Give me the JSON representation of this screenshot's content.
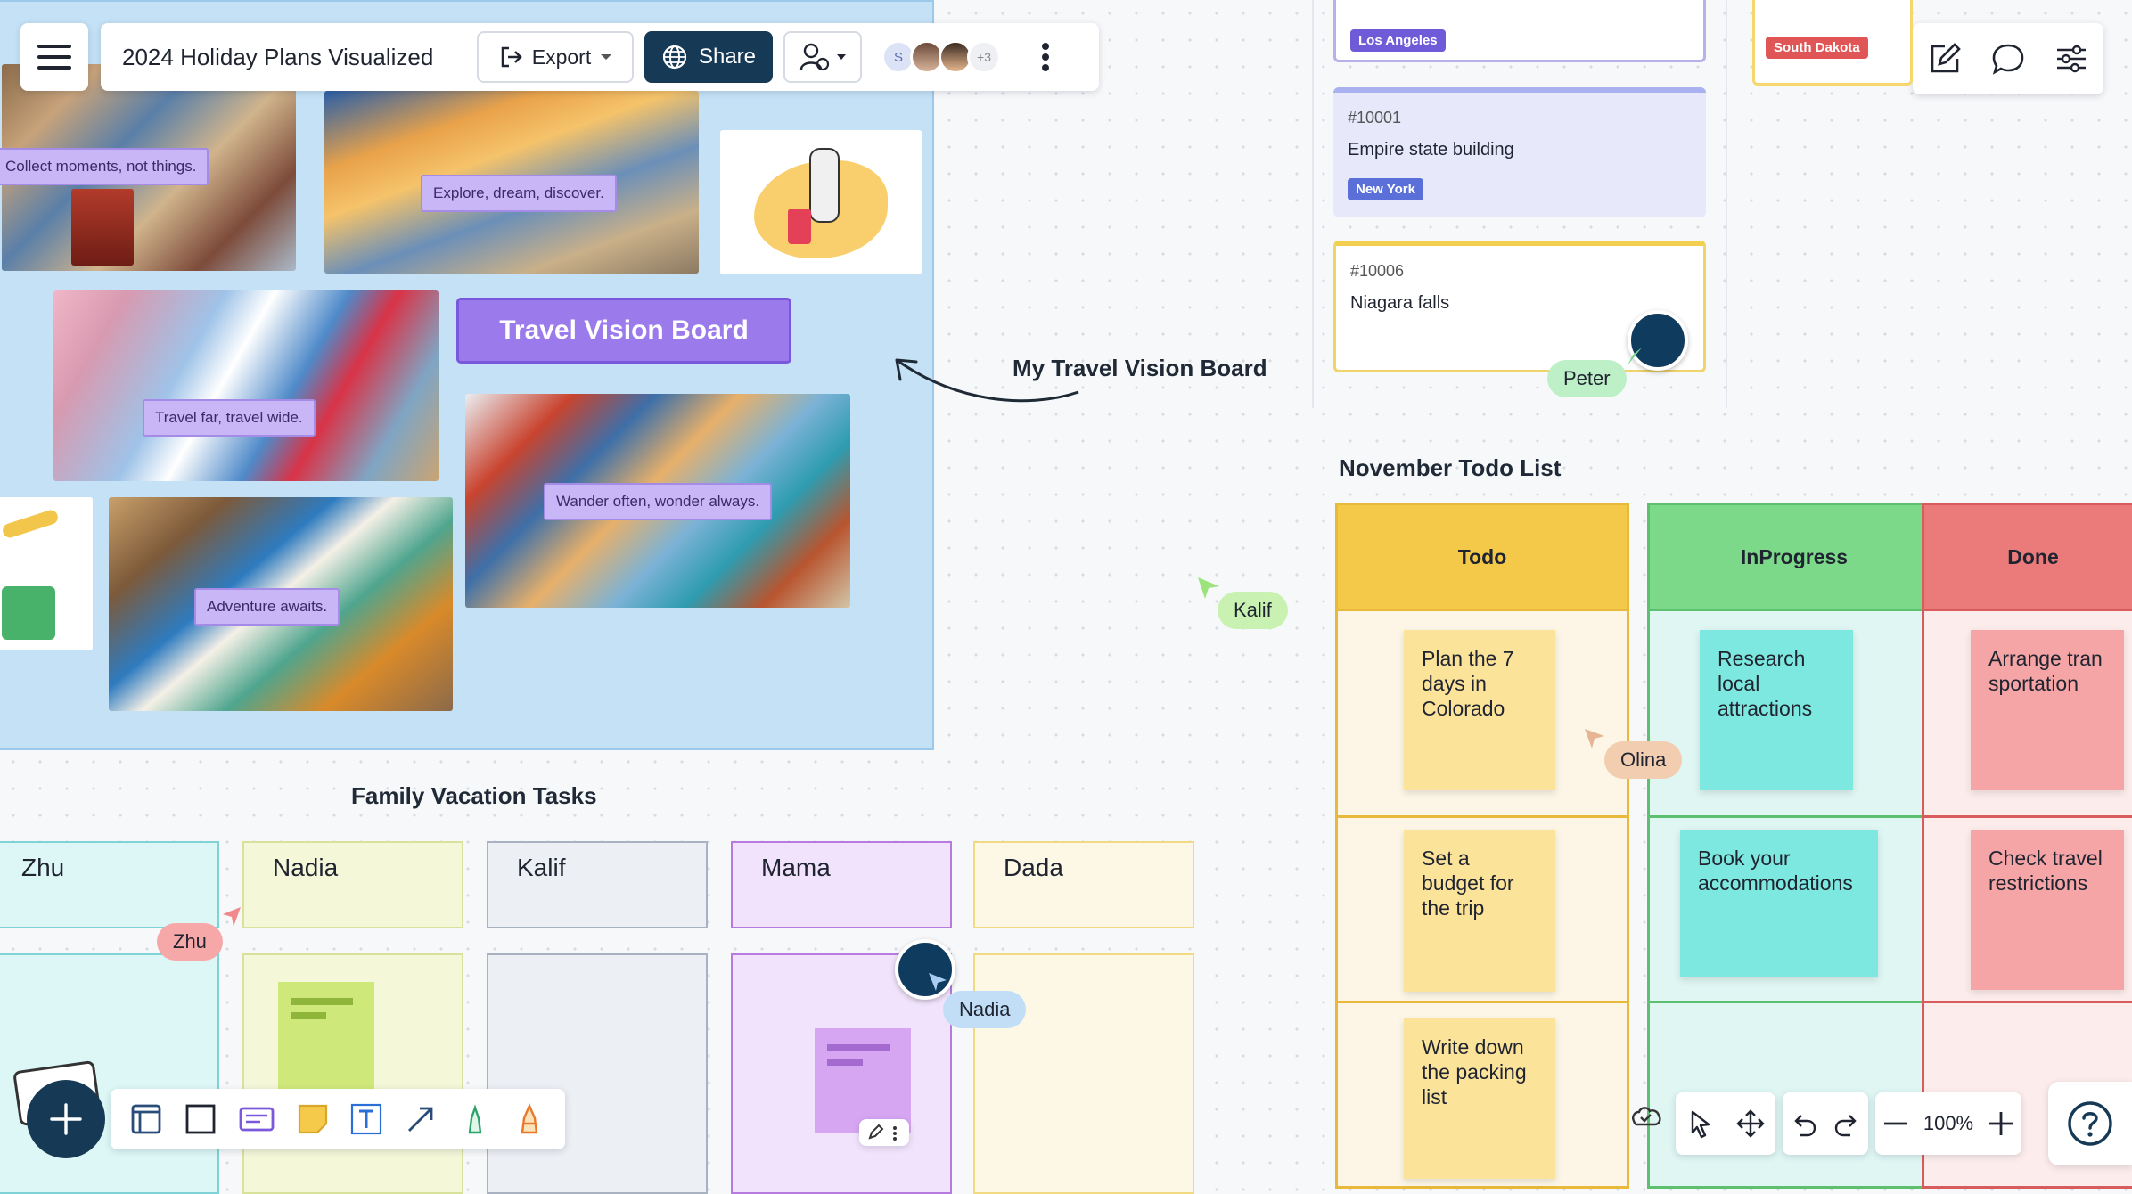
{
  "header": {
    "title": "2024 Holiday Plans Visualized",
    "export_label": "Export",
    "share_label": "Share",
    "avatar_initial": "S",
    "more_count": "+3"
  },
  "vision_board": {
    "title": "Travel Vision Board",
    "caption_collect": "Collect moments, not things.",
    "caption_explore": "Explore, dream, discover.",
    "caption_far": "Travel far, travel wide.",
    "caption_wander": "Wander often, wonder always.",
    "caption_adventure": "Adventure awaits.",
    "annotation": "My Travel Vision Board"
  },
  "tickets": [
    {
      "id": "",
      "text": "",
      "tag": "Los Angeles",
      "tag_color": "#6f5bd8"
    },
    {
      "id": "#10001",
      "text": "Empire state building",
      "tag": "New York",
      "tag_color": "#5a6fd8"
    },
    {
      "id": "#10006",
      "text": "Niagara falls",
      "tag": "",
      "tag_color": ""
    }
  ],
  "south_dakota_tag": "South Dakota",
  "cursors": {
    "peter": "Peter",
    "kalif": "Kalif",
    "olina": "Olina",
    "zhu": "Zhu",
    "nadia": "Nadia"
  },
  "todo": {
    "title": "November Todo List",
    "columns": [
      {
        "name": "Todo",
        "head_color": "#f4c94a",
        "body_color": "#fdf6e6",
        "border": "#e8b93a"
      },
      {
        "name": "InProgress",
        "head_color": "#7cd98a",
        "body_color": "#dff6f3",
        "border": "#5cc070"
      },
      {
        "name": "Done",
        "head_color": "#eb7b7b",
        "body_color": "#fdecec",
        "border": "#d95c5c"
      }
    ],
    "items": {
      "todo": [
        "Plan the 7 days in Colorado",
        "Set a budget for the trip",
        "Write down the packing list"
      ],
      "inprogress": [
        "Research local attractions",
        "Book your accommodations"
      ],
      "done": [
        "Arrange transportation",
        "Check travel restrictions"
      ]
    }
  },
  "family": {
    "title": "Family Vacation Tasks",
    "members": [
      "Zhu",
      "Nadia",
      "Kalif",
      "Mama",
      "Dada"
    ]
  },
  "zoom": {
    "level": "100%"
  },
  "icons": [
    "hamburger-icon",
    "export-icon",
    "globe-icon",
    "collab-icon",
    "kebab-icon",
    "edit-icon",
    "comment-icon",
    "settings-icon",
    "plus-icon",
    "frame-icon",
    "rectangle-icon",
    "card-icon",
    "sticky-icon",
    "text-icon",
    "arrow-icon",
    "pen-icon",
    "highlighter-icon",
    "cloud-icon",
    "pointer-icon",
    "pan-icon",
    "undo-icon",
    "redo-icon",
    "zoom-out-icon",
    "zoom-in-icon",
    "help-icon"
  ]
}
